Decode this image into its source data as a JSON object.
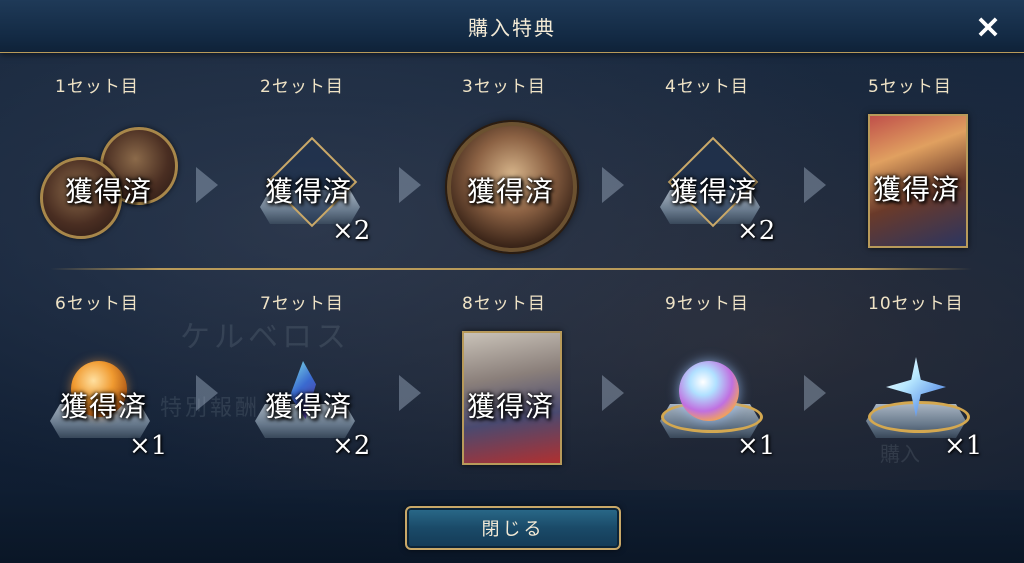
{
  "dialog": {
    "title": "購入特典",
    "close_icon": "×",
    "close_button_label": "閉じる"
  },
  "background_text": {
    "name": "ケルベロス",
    "subtitle": "特別報酬",
    "right_label": "購入"
  },
  "rewards": [
    {
      "label": "1セット目",
      "status": "獲得済",
      "quantity": "",
      "icon": "medal-coins-icon"
    },
    {
      "label": "2セット目",
      "status": "獲得済",
      "quantity": "×2",
      "icon": "frame-ticket-icon"
    },
    {
      "label": "3セット目",
      "status": "獲得済",
      "quantity": "",
      "icon": "character-medal-icon"
    },
    {
      "label": "4セット目",
      "status": "獲得済",
      "quantity": "×2",
      "icon": "frame-ticket-icon"
    },
    {
      "label": "5セット目",
      "status": "獲得済",
      "quantity": "",
      "icon": "character-card-icon"
    },
    {
      "label": "6セット目",
      "status": "獲得済",
      "quantity": "×1",
      "icon": "orange-orb-icon"
    },
    {
      "label": "7セット目",
      "status": "獲得済",
      "quantity": "×2",
      "icon": "crystal-shard-icon"
    },
    {
      "label": "8セット目",
      "status": "獲得済",
      "quantity": "",
      "icon": "character-card-icon"
    },
    {
      "label": "9セット目",
      "status": "",
      "quantity": "×1",
      "icon": "rainbow-orb-icon"
    },
    {
      "label": "10セット目",
      "status": "",
      "quantity": "×1",
      "icon": "star-crystal-icon"
    }
  ],
  "colors": {
    "accent_gold": "#b89a5a",
    "text_cream": "#efe3c6",
    "panel_dark": "#13233a"
  }
}
